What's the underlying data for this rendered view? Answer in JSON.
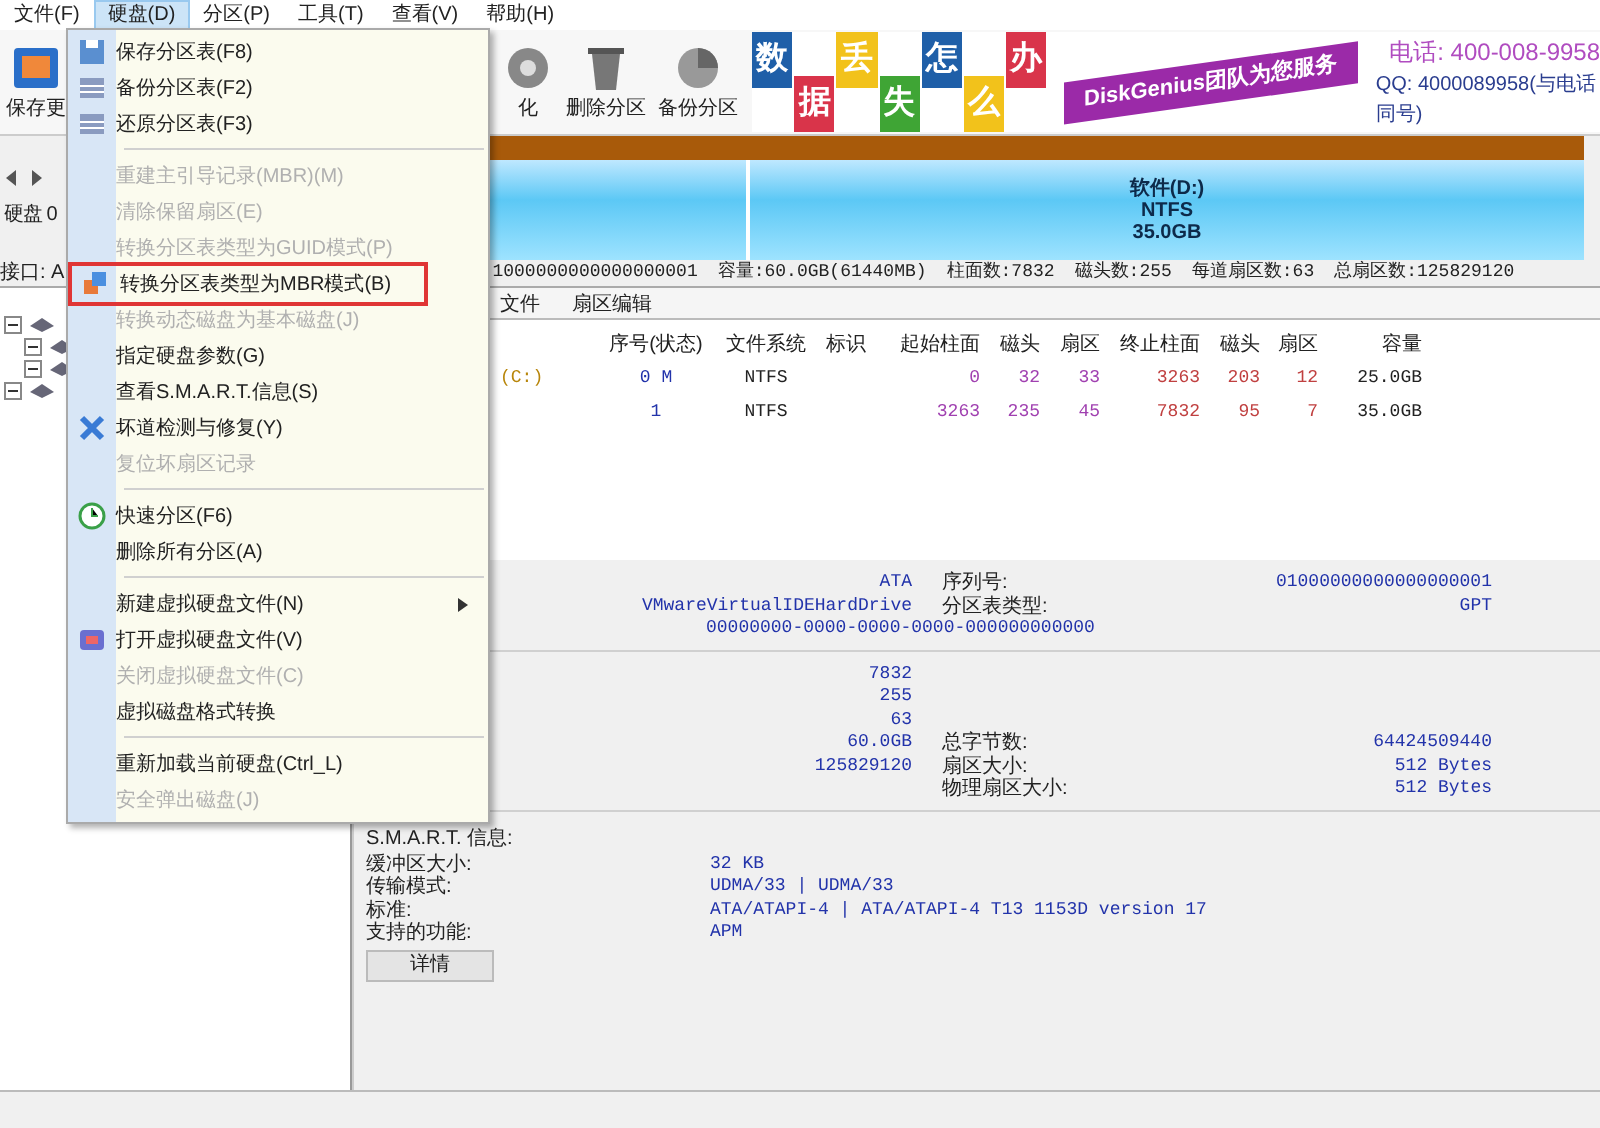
{
  "menu_bar": [
    {
      "label": "文件(F)",
      "selected": false
    },
    {
      "label": "硬盘(D)",
      "selected": true
    },
    {
      "label": "分区(P)",
      "selected": false
    },
    {
      "label": "工具(T)",
      "selected": false
    },
    {
      "label": "查看(V)",
      "selected": false
    },
    {
      "label": "帮助(H)",
      "selected": false
    }
  ],
  "toolbar": {
    "save_label": "保存更",
    "buttons": [
      {
        "label": "化"
      },
      {
        "label": "删除分区"
      },
      {
        "label": "备份分区"
      }
    ]
  },
  "banner": {
    "tiles": [
      {
        "char": "数",
        "color": "#1f5fa8"
      },
      {
        "char": "据",
        "color": "#d9344a"
      },
      {
        "char": "丢",
        "color": "#f2c21b"
      },
      {
        "char": "失",
        "color": "#3fa535"
      },
      {
        "char": "怎",
        "color": "#1f5fa8"
      },
      {
        "char": "么",
        "color": "#f2c21b"
      },
      {
        "char": "办",
        "color": "#d9344a"
      }
    ],
    "slogan": "DiskGenius团队为您服务",
    "phone": "电话: 400-008-9958",
    "qq": "QQ: 4000089958(与电话同号)"
  },
  "disk_panel": {
    "disk_label": "硬盘 0",
    "interface_label": "接口: A"
  },
  "disk_map": {
    "partitions": [
      {
        "label": "软件(D:)",
        "file_system": "NTFS",
        "size": "35.0GB"
      }
    ]
  },
  "info_line": [
    "1000000000000000001",
    "容量:60.0GB(61440MB)",
    "柱面数:7832",
    "磁头数:255",
    "每道扇区数:63",
    "总扇区数:125829120"
  ],
  "tabs": [
    {
      "label": "文件",
      "selected": false
    },
    {
      "label": "扇区编辑",
      "selected": false
    }
  ],
  "partition_table": {
    "columns": [
      "序号(状态)",
      "文件系统",
      "标识",
      "起始柱面",
      "磁头",
      "扇区",
      "终止柱面",
      "磁头",
      "扇区",
      "容量"
    ],
    "rows": [
      {
        "column_1": "(C:)",
        "number_status": "0 M",
        "file_system": "NTFS",
        "start_cylinder": "0",
        "start_head": "32",
        "start_sector": "33",
        "end_cylinder": "3263",
        "end_head": "203",
        "end_sector": "12",
        "capacity": "25.0GB"
      },
      {
        "number_status": "1",
        "file_system": "NTFS",
        "start_cylinder": "3263",
        "start_head": "235",
        "start_sector": "45",
        "end_cylinder": "7832",
        "end_head": "95",
        "end_sector": "7",
        "capacity": "35.0GB"
      }
    ]
  },
  "disk_details": {
    "groups": [
      [
        {
          "kind": "pair",
          "value": "ATA",
          "label": "序列号:",
          "value_2": "01000000000000000001"
        },
        {
          "kind": "pair",
          "value": "VMwareVirtualIDEHardDrive",
          "label": "分区表类型:",
          "value_2": "GPT"
        },
        {
          "kind": "wide",
          "value": "00000000-0000-0000-0000-000000000000"
        }
      ],
      [
        {
          "kind": "pair",
          "value": "7832"
        },
        {
          "kind": "pair",
          "value": "255"
        },
        {
          "kind": "pair",
          "value": "63"
        },
        {
          "kind": "pair",
          "value": "60.0GB",
          "label": "总字节数:",
          "value_2": "64424509440"
        },
        {
          "kind": "pair",
          "value": "125829120",
          "label": "扇区大小:",
          "value_2": "512 Bytes"
        },
        {
          "kind": "pair",
          "label": "物理扇区大小:",
          "value_2": "512 Bytes"
        }
      ]
    ]
  },
  "smart": {
    "title": "S.M.A.R.T. 信息:",
    "rows": [
      {
        "label": "缓冲区大小:",
        "value": "32 KB"
      },
      {
        "label": "传输模式:",
        "value": "UDMA/33 | UDMA/33"
      },
      {
        "label": "标准:",
        "value": "ATA/ATAPI-4 | ATA/ATAPI-4 T13 1153D version 17"
      },
      {
        "label": "支持的功能:",
        "value": "APM"
      }
    ],
    "button": "详情"
  },
  "dropdown": {
    "items": [
      {
        "kind": "item",
        "label": "保存分区表(F8)",
        "disabled": false,
        "highlighted": false,
        "submenu": false
      },
      {
        "kind": "item",
        "label": "备份分区表(F2)",
        "disabled": false,
        "highlighted": false,
        "submenu": false
      },
      {
        "kind": "item",
        "label": "还原分区表(F3)",
        "disabled": false,
        "highlighted": false,
        "submenu": false
      },
      {
        "kind": "separator"
      },
      {
        "kind": "item",
        "label": "重建主引导记录(MBR)(M)",
        "disabled": true,
        "highlighted": false,
        "submenu": false
      },
      {
        "kind": "item",
        "label": "清除保留扇区(E)",
        "disabled": true,
        "highlighted": false,
        "submenu": false
      },
      {
        "kind": "item",
        "label": "转换分区表类型为GUID模式(P)",
        "disabled": true,
        "highlighted": false,
        "submenu": false
      },
      {
        "kind": "item",
        "label": "转换分区表类型为MBR模式(B)",
        "disabled": false,
        "highlighted": true,
        "submenu": false
      },
      {
        "kind": "item",
        "label": "转换动态磁盘为基本磁盘(J)",
        "disabled": true,
        "highlighted": false,
        "submenu": false
      },
      {
        "kind": "item",
        "label": "指定硬盘参数(G)",
        "disabled": false,
        "highlighted": false,
        "submenu": false
      },
      {
        "kind": "item",
        "label": "查看S.M.A.R.T.信息(S)",
        "disabled": false,
        "highlighted": false,
        "submenu": false
      },
      {
        "kind": "item",
        "label": "坏道检测与修复(Y)",
        "disabled": false,
        "highlighted": false,
        "submenu": false
      },
      {
        "kind": "item",
        "label": "复位坏扇区记录",
        "disabled": true,
        "highlighted": false,
        "submenu": false
      },
      {
        "kind": "separator"
      },
      {
        "kind": "item",
        "label": "快速分区(F6)",
        "disabled": false,
        "highlighted": false,
        "submenu": false
      },
      {
        "kind": "item",
        "label": "删除所有分区(A)",
        "disabled": false,
        "highlighted": false,
        "submenu": false
      },
      {
        "kind": "separator"
      },
      {
        "kind": "item",
        "label": "新建虚拟硬盘文件(N)",
        "disabled": false,
        "highlighted": false,
        "submenu": true
      },
      {
        "kind": "item",
        "label": "打开虚拟硬盘文件(V)",
        "disabled": false,
        "highlighted": false,
        "submenu": false
      },
      {
        "kind": "item",
        "label": "关闭虚拟硬盘文件(C)",
        "disabled": true,
        "highlighted": false,
        "submenu": false
      },
      {
        "kind": "item",
        "label": "虚拟磁盘格式转换",
        "disabled": false,
        "highlighted": false,
        "submenu": false
      },
      {
        "kind": "separator"
      },
      {
        "kind": "item",
        "label": "重新加载当前硬盘(Ctrl_L)",
        "disabled": false,
        "highlighted": false,
        "submenu": false
      },
      {
        "kind": "item",
        "label": "安全弹出磁盘(J)",
        "disabled": true,
        "highlighted": false,
        "submenu": false
      }
    ]
  }
}
